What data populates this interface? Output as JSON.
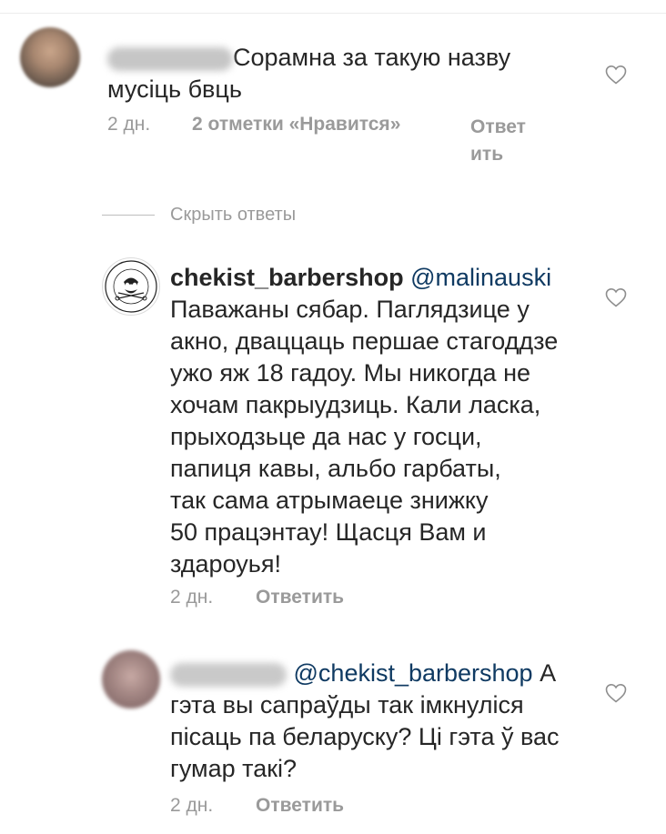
{
  "comment1": {
    "text_line1": "Сорамна за такую назву",
    "text_line2": "мусіць бвць",
    "time": "2 дн.",
    "likes": "2 отметки «Нравится»",
    "reply_line1": "Ответ",
    "reply_line2": "ить"
  },
  "replies": {
    "hide_label": "Скрыть ответы"
  },
  "reply1": {
    "username": "chekist_barbershop",
    "mention": "@malinauski",
    "lines": [
      "Паважаны сябар. Паглядзице у",
      "акно, дваццаць першае стагоддзе",
      "ужо яж 18 гадоу. Мы никогда не",
      "хочам пакрыудзиць. Кали ласка,",
      "прыходзьце да нас у госци,",
      "папиця кавы, альбо гарбаты,",
      "так сама атрымаеце знижку",
      "50 працэнтау! Щасця Вам и",
      "здароуья!"
    ],
    "time": "2 дн.",
    "reply": "Ответить",
    "logo_text_top": "BARBERSHOP",
    "logo_text_bottom": "CHEKIST"
  },
  "reply2": {
    "mention": "@chekist_barbershop",
    "first_tail": "А",
    "lines": [
      "гэта вы сапраўды так імкнуліся",
      "пісаць па беларуску? Ці гэта ў вас",
      "гумар такі?"
    ],
    "time": "2 дн.",
    "reply": "Ответить"
  },
  "colors": {
    "text": "#262626",
    "meta": "#9a9a9a",
    "mention": "#0f3a62",
    "heart": "#8e8e8e"
  },
  "icons": [
    "heart-icon",
    "barbershop-logo"
  ]
}
